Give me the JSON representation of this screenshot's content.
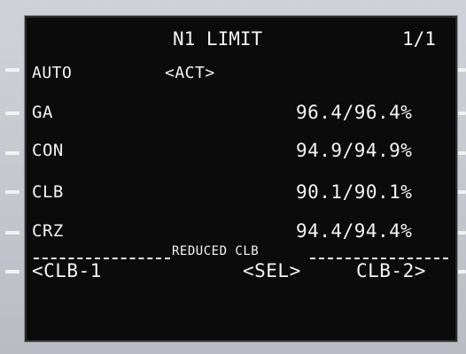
{
  "page": {
    "title": "N1 LIMIT",
    "page_number": "1/1"
  },
  "rows": {
    "auto": {
      "label": "AUTO",
      "marker": "<ACT>"
    },
    "ga": {
      "label": "GA",
      "value": "96.4/96.4%"
    },
    "con": {
      "label": "CON",
      "value": "94.9/94.9%"
    },
    "clb": {
      "label": "CLB",
      "value": "90.1/90.1%"
    },
    "crz": {
      "label": "CRZ",
      "value": "94.4/94.4%"
    }
  },
  "reduced": {
    "header": "REDUCED CLB",
    "left": "<CLB-1",
    "center": "<SEL>",
    "right": "CLB-2>"
  },
  "colors": {
    "screen_bg": "#0b0b0b",
    "text": "#f4f4f4",
    "bezel": "#c9ccd2"
  }
}
